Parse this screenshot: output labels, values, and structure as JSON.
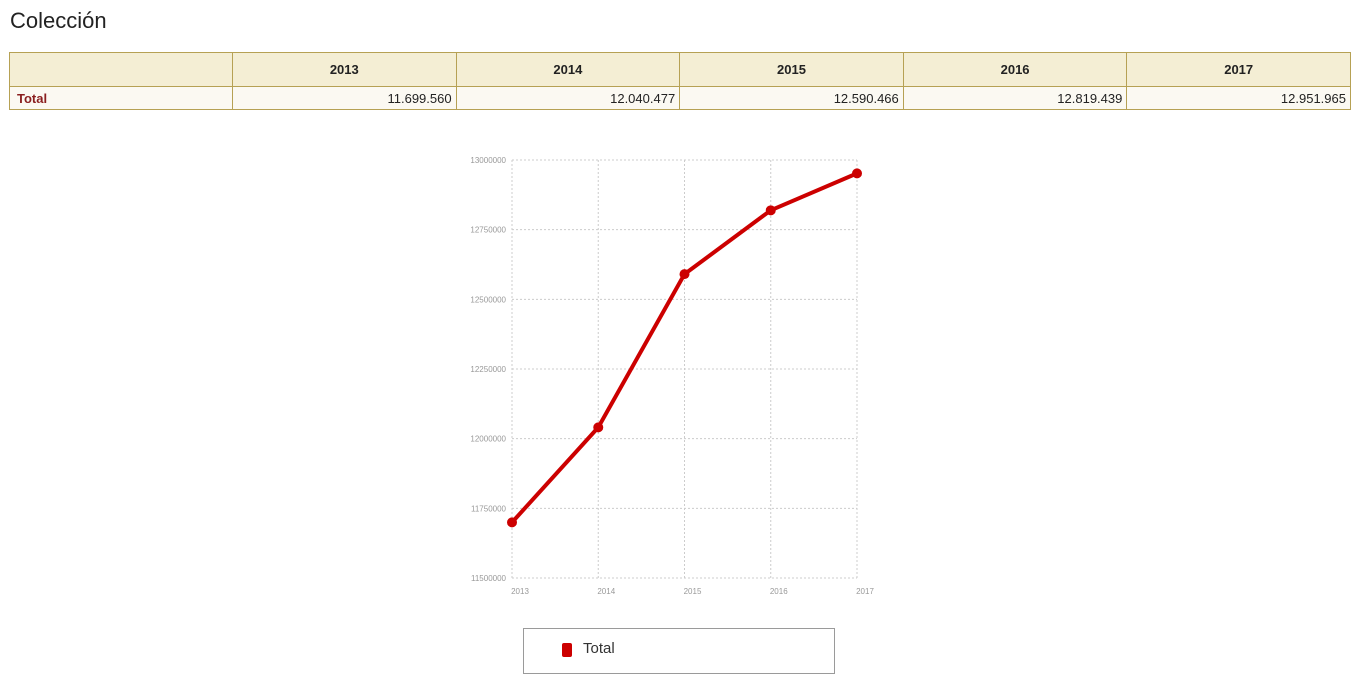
{
  "page": {
    "title": "Colección"
  },
  "table": {
    "headers": [
      "",
      "2013",
      "2014",
      "2015",
      "2016",
      "2017"
    ],
    "rows": [
      {
        "label": "Total",
        "values": [
          "11.699.560",
          "12.040.477",
          "12.590.466",
          "12.819.439",
          "12.951.965"
        ]
      }
    ]
  },
  "colors": {
    "series": "#cc0000",
    "grid": "#cccccc",
    "table_border": "#b6a154",
    "header_bg": "#f4eed4",
    "row_label": "#8a1f1f"
  },
  "chart_data": {
    "type": "line",
    "categories": [
      "2013",
      "2014",
      "2015",
      "2016",
      "2017"
    ],
    "series": [
      {
        "name": "Total",
        "values": [
          11699560,
          12040477,
          12590466,
          12819439,
          12951965
        ]
      }
    ],
    "yticks": [
      "11500000",
      "11750000",
      "12000000",
      "12250000",
      "12500000",
      "12750000",
      "13000000"
    ],
    "ylim": [
      11500000,
      13000000
    ],
    "grid": true,
    "legend_position": "bottom"
  }
}
